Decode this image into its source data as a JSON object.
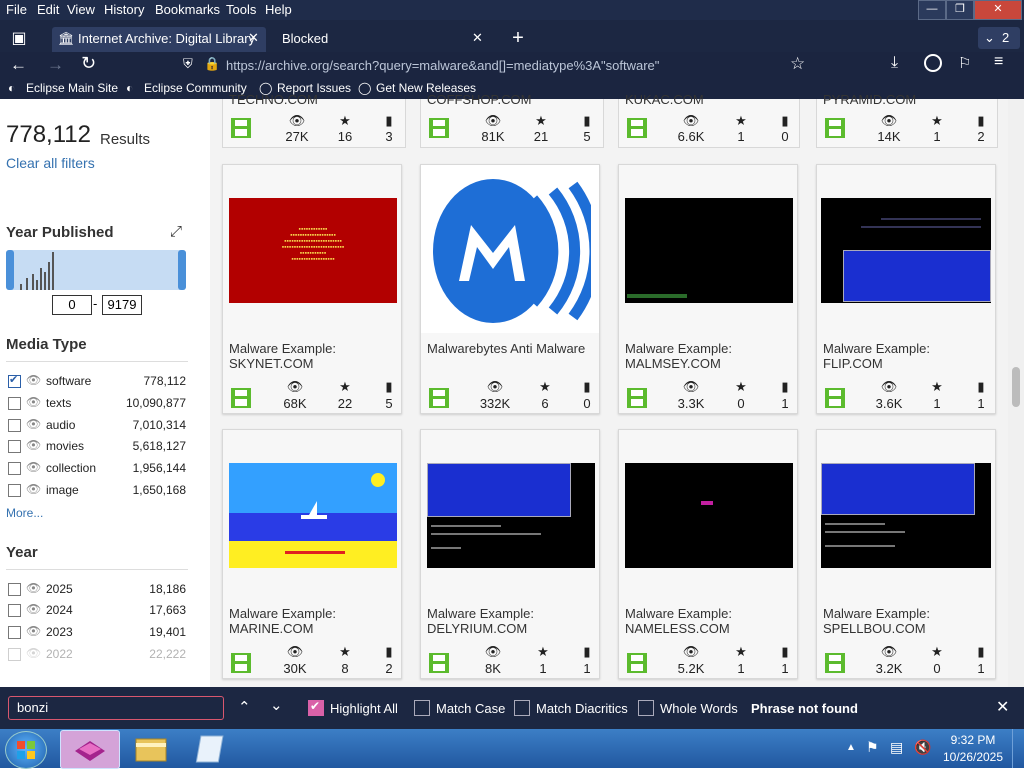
{
  "menu": {
    "items": [
      "File",
      "Edit",
      "View",
      "History",
      "Bookmarks",
      "Tools",
      "Help"
    ]
  },
  "tabs": [
    {
      "label": "Internet Archive: Digital Library",
      "active": true
    },
    {
      "label": "Blocked",
      "active": false
    }
  ],
  "tab_count": "2",
  "url": "https://archive.org/search?query=malware&and[]=mediatype%3A\"software\"",
  "bookmarks": [
    "Eclipse Main Site",
    "Eclipse Community",
    "Report Issues",
    "Get New Releases"
  ],
  "sidebar": {
    "results_count": "778,112",
    "results_label": "Results",
    "clear_filters": "Clear all filters",
    "year_published": "Year Published",
    "year_from": "0",
    "year_to": "9179",
    "media_type_title": "Media Type",
    "media_types": [
      {
        "label": "software",
        "count": "778,112",
        "checked": true
      },
      {
        "label": "texts",
        "count": "10,090,877",
        "checked": false
      },
      {
        "label": "audio",
        "count": "7,010,314",
        "checked": false
      },
      {
        "label": "movies",
        "count": "5,618,127",
        "checked": false
      },
      {
        "label": "collection",
        "count": "1,956,144",
        "checked": false
      },
      {
        "label": "image",
        "count": "1,650,168",
        "checked": false
      }
    ],
    "more": "More...",
    "year_title": "Year",
    "years": [
      {
        "label": "2025",
        "count": "18,186"
      },
      {
        "label": "2024",
        "count": "17,663"
      },
      {
        "label": "2023",
        "count": "19,401"
      },
      {
        "label": "2022",
        "count": "22,222"
      }
    ]
  },
  "top_row": [
    {
      "title": "TECHNO.COM",
      "views": "27K",
      "favs": "16",
      "reviews": "3"
    },
    {
      "title": "COFFSHOP.COM",
      "views": "81K",
      "favs": "21",
      "reviews": "5"
    },
    {
      "title": "KUKAC.COM",
      "views": "6.6K",
      "favs": "1",
      "reviews": "0"
    },
    {
      "title": "PYRAMID.COM",
      "views": "14K",
      "favs": "1",
      "reviews": "2"
    }
  ],
  "cards": [
    {
      "title": "Malware Example: SKYNET.COM",
      "views": "68K",
      "favs": "22",
      "reviews": "5"
    },
    {
      "title": "Malwarebytes Anti Malware",
      "views": "332K",
      "favs": "6",
      "reviews": "0"
    },
    {
      "title": "Malware Example: MALMSEY.COM",
      "views": "3.3K",
      "favs": "0",
      "reviews": "1"
    },
    {
      "title": "Malware Example: FLIP.COM",
      "views": "3.6K",
      "favs": "1",
      "reviews": "1"
    },
    {
      "title": "Malware Example: MARINE.COM",
      "views": "30K",
      "favs": "8",
      "reviews": "2"
    },
    {
      "title": "Malware Example: DELYRIUM.COM",
      "views": "8K",
      "favs": "1",
      "reviews": "1"
    },
    {
      "title": "Malware Example: NAMELESS.COM",
      "views": "5.2K",
      "favs": "1",
      "reviews": "1"
    },
    {
      "title": "Malware Example: SPELLBOU.COM",
      "views": "3.2K",
      "favs": "0",
      "reviews": "1"
    }
  ],
  "findbar": {
    "query": "bonzi",
    "highlight_all": "Highlight All",
    "match_case": "Match Case",
    "match_diacritics": "Match Diacritics",
    "whole_words": "Whole Words",
    "status": "Phrase not found"
  },
  "taskbar": {
    "time": "9:32 PM",
    "date": "10/26/2025"
  },
  "colors": {
    "accent": "#4a90d9",
    "save_green": "#5cbb2e",
    "browser_dark": "#1c2742"
  }
}
